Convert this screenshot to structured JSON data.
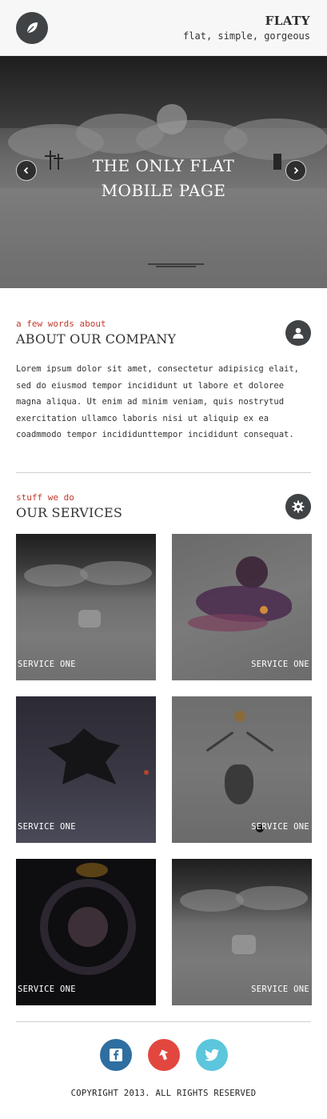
{
  "header": {
    "brand": "FLATY",
    "tagline": "flat, simple, gorgeous",
    "logo_icon": "leaf-icon"
  },
  "hero": {
    "title_line1": "THE ONLY FLAT",
    "title_line2": "MOBILE PAGE",
    "prev_icon": "chevron-left-icon",
    "next_icon": "chevron-right-icon"
  },
  "about": {
    "subtitle": "a few words about",
    "title": "ABOUT OUR COMPANY",
    "icon": "user-icon",
    "text": "Lorem ipsum dolor sit amet, consectetur adipisicg elait, sed do eiusmod tempor incididunt ut labore et doloree magna aliqua. Ut enim ad minim veniam, quis nostrytud exercitation ullamco laboris nisi ut aliquip ex ea coadmmodo tempor incididunttempor incididunt consequat."
  },
  "services": {
    "subtitle": "stuff we do",
    "title": "OUR SERVICES",
    "icon": "gear-icon",
    "items": [
      {
        "label": "SERVICE ONE"
      },
      {
        "label": "SERVICE ONE"
      },
      {
        "label": "SERVICE ONE"
      },
      {
        "label": "SERVICE ONE"
      },
      {
        "label": "SERVICE ONE"
      },
      {
        "label": "SERVICE ONE"
      }
    ]
  },
  "footer": {
    "social": [
      {
        "name": "facebook",
        "icon": "facebook-icon",
        "color": "#2f6ea0"
      },
      {
        "name": "share",
        "icon": "share-icon",
        "color": "#e2473f"
      },
      {
        "name": "twitter",
        "icon": "twitter-icon",
        "color": "#5bc6dc"
      }
    ],
    "copyright": "COPYRIGHT 2013. ALL RIGHTS RESERVED"
  },
  "colors": {
    "accent_red": "#c0392b",
    "dark_icon_bg": "#3f4346"
  }
}
